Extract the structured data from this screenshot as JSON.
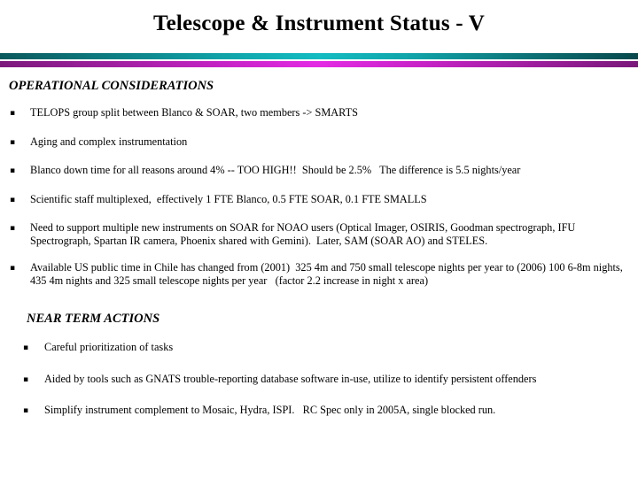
{
  "slide": {
    "title": "Telescope & Instrument Status - V",
    "divider": {
      "teal_edge_color": "#0b585c",
      "teal_center_color": "#13bcc1",
      "magenta_edge_color": "#7c197c",
      "magenta_center_color": "#e32ae3"
    },
    "sections": [
      {
        "heading": "OPERATIONAL CONSIDERATIONS",
        "bullet_glyph": "square-bullet",
        "items": [
          "TELOPS group split between Blanco & SOAR, two members -> SMARTS",
          "Aging and complex instrumentation",
          "Blanco down time for all reasons around 4% -- TOO HIGH!!  Should be 2.5%   The difference is 5.5 nights/year",
          "Scientific staff multiplexed,  effectively 1 FTE Blanco, 0.5 FTE SOAR, 0.1 FTE SMALLS",
          "Need to support multiple new instruments on SOAR for NOAO users (Optical Imager, OSIRIS, Goodman spectrograph, IFU Spectrograph, Spartan IR camera, Phoenix shared with Gemini).  Later, SAM (SOAR AO) and STELES.",
          "Available US public time in Chile has changed from (2001)  325 4m and 750 small telescope nights per year to (2006) 100 6-8m nights, 435 4m nights and 325 small telescope nights per year   (factor 2.2 increase in night x area)"
        ]
      },
      {
        "heading": "NEAR TERM ACTIONS",
        "bullet_glyph": "square-bullet",
        "items": [
          "Careful prioritization of tasks",
          "Aided by tools such as GNATS trouble-reporting database software in-use, utilize to identify persistent offenders",
          "Simplify instrument complement to Mosaic, Hydra, ISPI.   RC Spec only in 2005A, single blocked run."
        ]
      }
    ]
  }
}
